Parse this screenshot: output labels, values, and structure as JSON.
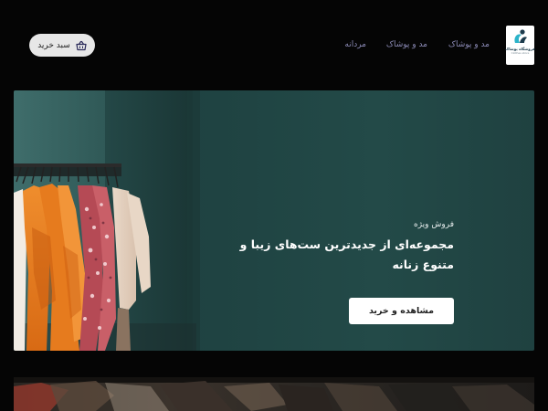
{
  "header": {
    "logo": {
      "icon": "store-logo-icon",
      "text": "فروشگاه پوشاک",
      "subtext": "Clothes store"
    },
    "nav": [
      {
        "label": "مد و پوشاک"
      },
      {
        "label": "مد و پوشاک"
      },
      {
        "label": "مردانه"
      }
    ],
    "cart": {
      "label": "سبد خرید",
      "icon": "shopping-basket-icon"
    }
  },
  "hero": {
    "kicker": "فروش ویژه",
    "title": "مجموعه‌ای از جدیدترین ست‌های زیبا و متنوع زنانه",
    "cta_label": "مشاهده و خرید",
    "image": "clothing-rack-photo",
    "background_color": "#1f4342"
  },
  "banner2": {
    "image": "clothing-store-photo"
  },
  "colors": {
    "page_bg": "#050505",
    "nav_text": "#8b8ab5",
    "cart_bg": "#e7e7e7",
    "cta_bg": "#ffffff"
  }
}
